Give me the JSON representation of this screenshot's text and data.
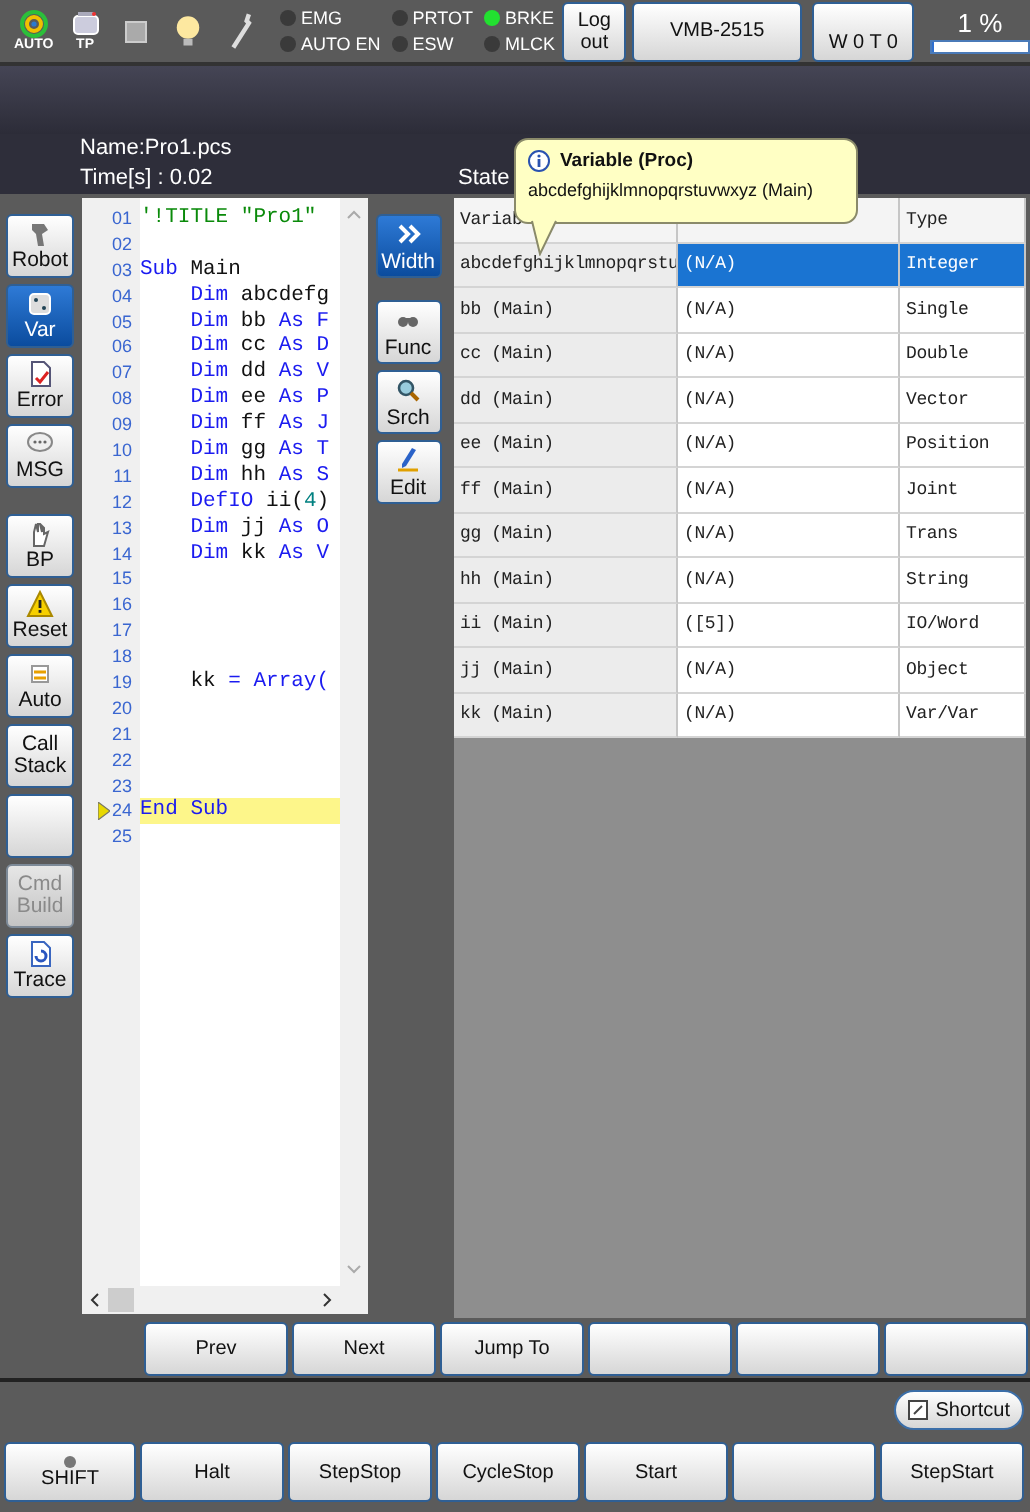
{
  "top_bar": {
    "mode_label": "AUTO",
    "pendant_label": "TP",
    "indicators": [
      {
        "label": "EMG",
        "on": false
      },
      {
        "label": "AUTO EN",
        "on": false
      },
      {
        "label": "PRTOT",
        "on": false
      },
      {
        "label": "ESW",
        "on": false
      },
      {
        "label": "BRKE",
        "on": true
      },
      {
        "label": "MLCK",
        "on": false
      }
    ],
    "logout_button": "Log out",
    "robot_button": "VMB-2515",
    "weight_button": "W 0 T 0",
    "speed": {
      "reading": "1 %",
      "level": 0.01
    }
  },
  "header": {
    "name": "Name:Pro1.pcs",
    "time": "Time[s] : 0.02",
    "state": "State"
  },
  "sidebar": {
    "upper": [
      {
        "label": "Robot",
        "selected": false,
        "disabled": false
      },
      {
        "label": "Var",
        "selected": true,
        "disabled": false
      },
      {
        "label": "Error",
        "selected": false,
        "disabled": false
      },
      {
        "label": "MSG",
        "selected": false,
        "disabled": false
      }
    ],
    "lower": [
      {
        "label": "BP",
        "selected": false,
        "disabled": false
      },
      {
        "label": "Reset",
        "selected": false,
        "disabled": false
      },
      {
        "label": "Auto",
        "selected": false,
        "disabled": false
      },
      {
        "label": "Call Stack",
        "selected": false,
        "disabled": false
      },
      {
        "selected": false,
        "disabled": false
      },
      {
        "label": "Cmd Build",
        "selected": false,
        "disabled": true
      },
      {
        "label": "Trace",
        "selected": false,
        "disabled": false
      }
    ]
  },
  "editor": {
    "lines": [
      {
        "number": "01",
        "current": false,
        "tokens": [
          {
            "text": "'!TITLE \"Pro1\"",
            "kind": "comment"
          }
        ]
      },
      {
        "number": "02",
        "current": false
      },
      {
        "number": "03",
        "current": false,
        "tokens": [
          {
            "text": "Sub",
            "kind": "keyword"
          },
          {
            "text": " Main",
            "kind": "plain"
          }
        ]
      },
      {
        "number": "04",
        "current": false,
        "tokens": [
          {
            "text": "    Dim",
            "kind": "keyword"
          },
          {
            "text": " abcdefg",
            "kind": "plain"
          }
        ]
      },
      {
        "number": "05",
        "current": false,
        "tokens": [
          {
            "text": "    Dim",
            "kind": "keyword"
          },
          {
            "text": " bb ",
            "kind": "plain"
          },
          {
            "text": "As F",
            "kind": "keyword"
          }
        ]
      },
      {
        "number": "06",
        "current": false,
        "tokens": [
          {
            "text": "    Dim",
            "kind": "keyword"
          },
          {
            "text": " cc ",
            "kind": "plain"
          },
          {
            "text": "As D",
            "kind": "keyword"
          }
        ]
      },
      {
        "number": "07",
        "current": false,
        "tokens": [
          {
            "text": "    Dim",
            "kind": "keyword"
          },
          {
            "text": " dd ",
            "kind": "plain"
          },
          {
            "text": "As V",
            "kind": "keyword"
          }
        ]
      },
      {
        "number": "08",
        "current": false,
        "tokens": [
          {
            "text": "    Dim",
            "kind": "keyword"
          },
          {
            "text": " ee ",
            "kind": "plain"
          },
          {
            "text": "As P",
            "kind": "keyword"
          }
        ]
      },
      {
        "number": "09",
        "current": false,
        "tokens": [
          {
            "text": "    Dim",
            "kind": "keyword"
          },
          {
            "text": " ff ",
            "kind": "plain"
          },
          {
            "text": "As J",
            "kind": "keyword"
          }
        ]
      },
      {
        "number": "10",
        "current": false,
        "tokens": [
          {
            "text": "    Dim",
            "kind": "keyword"
          },
          {
            "text": " gg ",
            "kind": "plain"
          },
          {
            "text": "As T",
            "kind": "keyword"
          }
        ]
      },
      {
        "number": "11",
        "current": false,
        "tokens": [
          {
            "text": "    Dim",
            "kind": "keyword"
          },
          {
            "text": " hh ",
            "kind": "plain"
          },
          {
            "text": "As S",
            "kind": "keyword"
          }
        ]
      },
      {
        "number": "12",
        "current": false,
        "tokens": [
          {
            "text": "    DefIO",
            "kind": "keyword"
          },
          {
            "text": " ii(",
            "kind": "plain"
          },
          {
            "text": "4",
            "kind": "number"
          },
          {
            "text": ")",
            "kind": "plain"
          }
        ]
      },
      {
        "number": "13",
        "current": false,
        "tokens": [
          {
            "text": "    Dim",
            "kind": "keyword"
          },
          {
            "text": " jj ",
            "kind": "plain"
          },
          {
            "text": "As O",
            "kind": "keyword"
          }
        ]
      },
      {
        "number": "14",
        "current": false,
        "tokens": [
          {
            "text": "    Dim",
            "kind": "keyword"
          },
          {
            "text": " kk ",
            "kind": "plain"
          },
          {
            "text": "As V",
            "kind": "keyword"
          }
        ]
      },
      {
        "number": "15",
        "current": false
      },
      {
        "number": "16",
        "current": false
      },
      {
        "number": "17",
        "current": false
      },
      {
        "number": "18",
        "current": false
      },
      {
        "number": "19",
        "current": false,
        "tokens": [
          {
            "text": "    kk ",
            "kind": "plain"
          },
          {
            "text": "= Array(",
            "kind": "keyword"
          }
        ]
      },
      {
        "number": "20",
        "current": false
      },
      {
        "number": "21",
        "current": false
      },
      {
        "number": "22",
        "current": false
      },
      {
        "number": "23",
        "current": false
      },
      {
        "number": "24",
        "current": true,
        "tokens": [
          {
            "text": "End Sub",
            "kind": "keyword"
          }
        ]
      },
      {
        "number": "25",
        "current": false
      }
    ]
  },
  "tools": [
    {
      "label": "Width",
      "selected": true
    },
    {
      "label": "Func",
      "selected": false
    },
    {
      "label": "Srch",
      "selected": false
    },
    {
      "label": "Edit",
      "selected": false
    }
  ],
  "tooltip": {
    "title": "Variable (Proc)",
    "text": "abcdefghijklmnopqrstuvwxyz (Main)"
  },
  "table": {
    "header": {
      "column_1": "Variab",
      "column_3": "Type"
    },
    "rows": [
      {
        "name": "abcdefghijklmnopqrstu",
        "value": "(N/A)",
        "type": "Integer",
        "selected": true
      },
      {
        "name": "bb (Main)",
        "value": "(N/A)",
        "type": "Single",
        "selected": false
      },
      {
        "name": "cc (Main)",
        "value": "(N/A)",
        "type": "Double",
        "selected": false
      },
      {
        "name": "dd (Main)",
        "value": "(N/A)",
        "type": "Vector",
        "selected": false
      },
      {
        "name": "ee (Main)",
        "value": "(N/A)",
        "type": "Position",
        "selected": false
      },
      {
        "name": "ff (Main)",
        "value": "(N/A)",
        "type": "Joint",
        "selected": false
      },
      {
        "name": "gg (Main)",
        "value": "(N/A)",
        "type": "Trans",
        "selected": false
      },
      {
        "name": "hh (Main)",
        "value": "(N/A)",
        "type": "String",
        "selected": false
      },
      {
        "name": "ii (Main)",
        "value": "([5])",
        "type": "IO/Word",
        "selected": false
      },
      {
        "name": "jj (Main)",
        "value": "(N/A)",
        "type": "Object",
        "selected": false
      },
      {
        "name": "kk (Main)",
        "value": "(N/A)",
        "type": "Var/Var",
        "selected": false
      }
    ]
  },
  "nav_buttons": [
    {
      "label": "Prev",
      "disabled": false
    },
    {
      "label": "Next",
      "disabled": false
    },
    {
      "label": "Jump To",
      "disabled": false
    },
    {
      "disabled": false
    },
    {
      "disabled": false
    },
    {
      "disabled": false
    }
  ],
  "shortcut_button": "Shortcut",
  "bottom_buttons": [
    {
      "label": "SHIFT",
      "kind": "shift"
    },
    {
      "label": "Halt",
      "kind": "plain"
    },
    {
      "label": "StepStop",
      "kind": "plain"
    },
    {
      "label": "CycleStop",
      "kind": "plain"
    },
    {
      "label": "Start",
      "kind": "plain"
    },
    {
      "kind": "plain"
    },
    {
      "label": "StepStart",
      "kind": "plain"
    }
  ]
}
